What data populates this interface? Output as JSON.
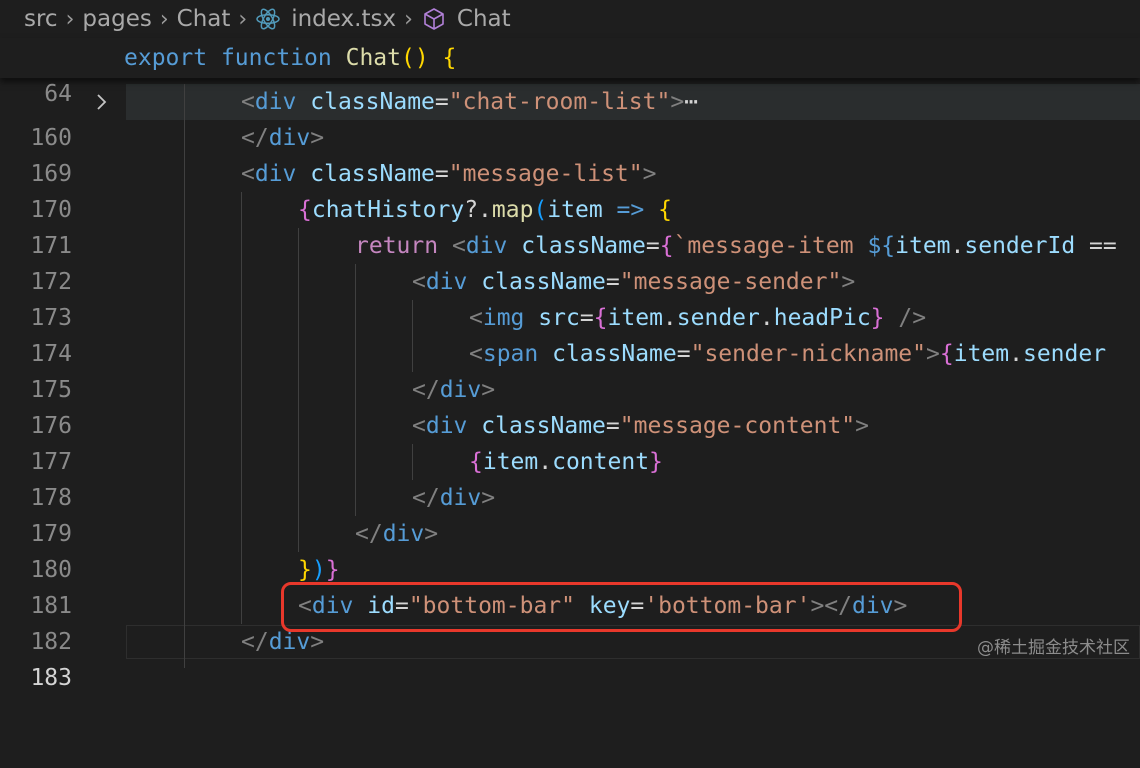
{
  "breadcrumb": {
    "items": [
      "src",
      "pages",
      "Chat",
      "index.tsx",
      "Chat"
    ],
    "icons": [
      "react-icon",
      "symbol-box-icon"
    ]
  },
  "sticky_scroll": {
    "line_number": "64",
    "code": "export function Chat() {"
  },
  "lines": [
    {
      "num": "160",
      "folded": true,
      "text": "<div className=\"chat-room-list\">⋯"
    },
    {
      "num": "169",
      "text": "</div>"
    },
    {
      "num": "170",
      "text": "<div className=\"message-list\">"
    },
    {
      "num": "171",
      "text": "{chatHistory?.map(item => {"
    },
    {
      "num": "172",
      "text": "return <div className={`message-item ${item.senderId =="
    },
    {
      "num": "173",
      "text": "<div className=\"message-sender\">"
    },
    {
      "num": "174",
      "text": "<img src={item.sender.headPic} />"
    },
    {
      "num": "175",
      "text": "<span className=\"sender-nickname\">{item.sender"
    },
    {
      "num": "176",
      "text": "</div>"
    },
    {
      "num": "177",
      "text": "<div className=\"message-content\">"
    },
    {
      "num": "178",
      "text": "{item.content}"
    },
    {
      "num": "179",
      "text": "</div>"
    },
    {
      "num": "180",
      "text": "</div>"
    },
    {
      "num": "181",
      "text": "})}"
    },
    {
      "num": "182",
      "text": "<div id=\"bottom-bar\" key='bottom-bar'></div>"
    },
    {
      "num": "183",
      "text": "</div>",
      "current": true
    }
  ],
  "watermark": "@稀土掘金技术社区",
  "colors": {
    "background": "#1e1e1e",
    "highlight_box": "#e8382b"
  }
}
